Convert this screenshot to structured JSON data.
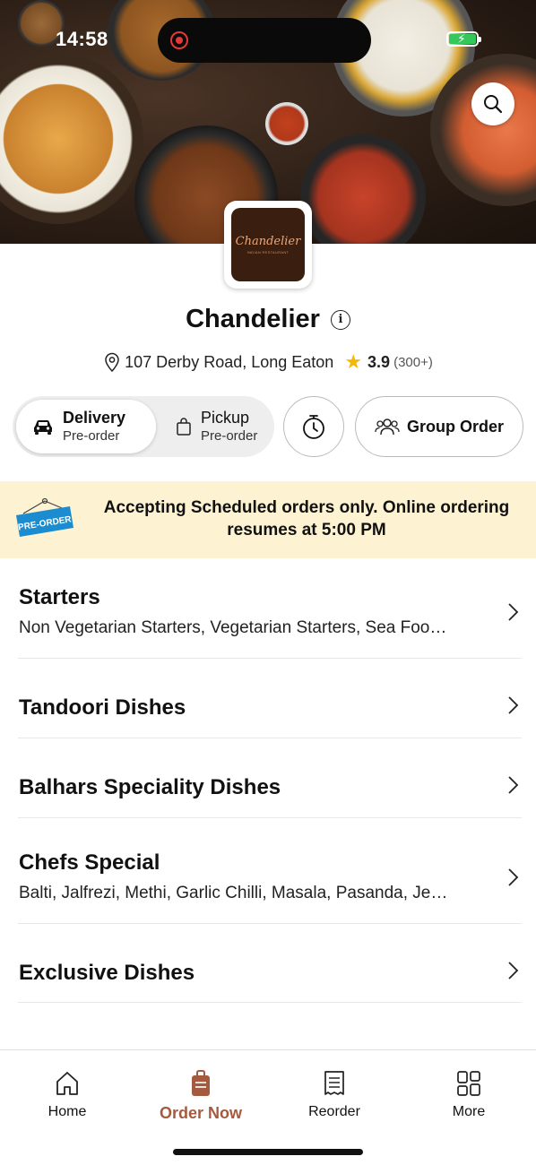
{
  "status_bar": {
    "time": "14:58"
  },
  "restaurant": {
    "logo_text": "Chandelier",
    "logo_subtext": "INDIAN RESTAURANT",
    "name": "Chandelier",
    "address": "107 Derby Road, Long Eaton",
    "rating": "3.9",
    "rating_count": "(300+)"
  },
  "order_mode": {
    "delivery": {
      "label": "Delivery",
      "sub": "Pre-order"
    },
    "pickup": {
      "label": "Pickup",
      "sub": "Pre-order"
    },
    "group_order_label": "Group Order",
    "selected": "delivery"
  },
  "banner": {
    "tag": "PRE-ORDER",
    "message": "Accepting Scheduled orders only. Online ordering resumes at 5:00 PM"
  },
  "menu": [
    {
      "name": "Starters",
      "desc": "Non Vegetarian Starters, Vegetarian Starters, Sea Foo…"
    },
    {
      "name": "Tandoori Dishes",
      "desc": ""
    },
    {
      "name": "Balhars Speciality Dishes",
      "desc": ""
    },
    {
      "name": "Chefs Special",
      "desc": "Balti, Jalfrezi, Methi, Garlic Chilli, Masala, Pasanda, Je…"
    },
    {
      "name": "Exclusive Dishes",
      "desc": ""
    }
  ],
  "tabs": [
    {
      "label": "Home",
      "icon": "home-icon"
    },
    {
      "label": "Order Now",
      "icon": "order-bag-icon"
    },
    {
      "label": "Reorder",
      "icon": "receipt-icon"
    },
    {
      "label": "More",
      "icon": "grid-icon"
    }
  ],
  "colors": {
    "accent": "#a45a3e",
    "banner_bg": "#fdf3d2",
    "star": "#f5b800",
    "tag_blue": "#1a8ccf"
  }
}
